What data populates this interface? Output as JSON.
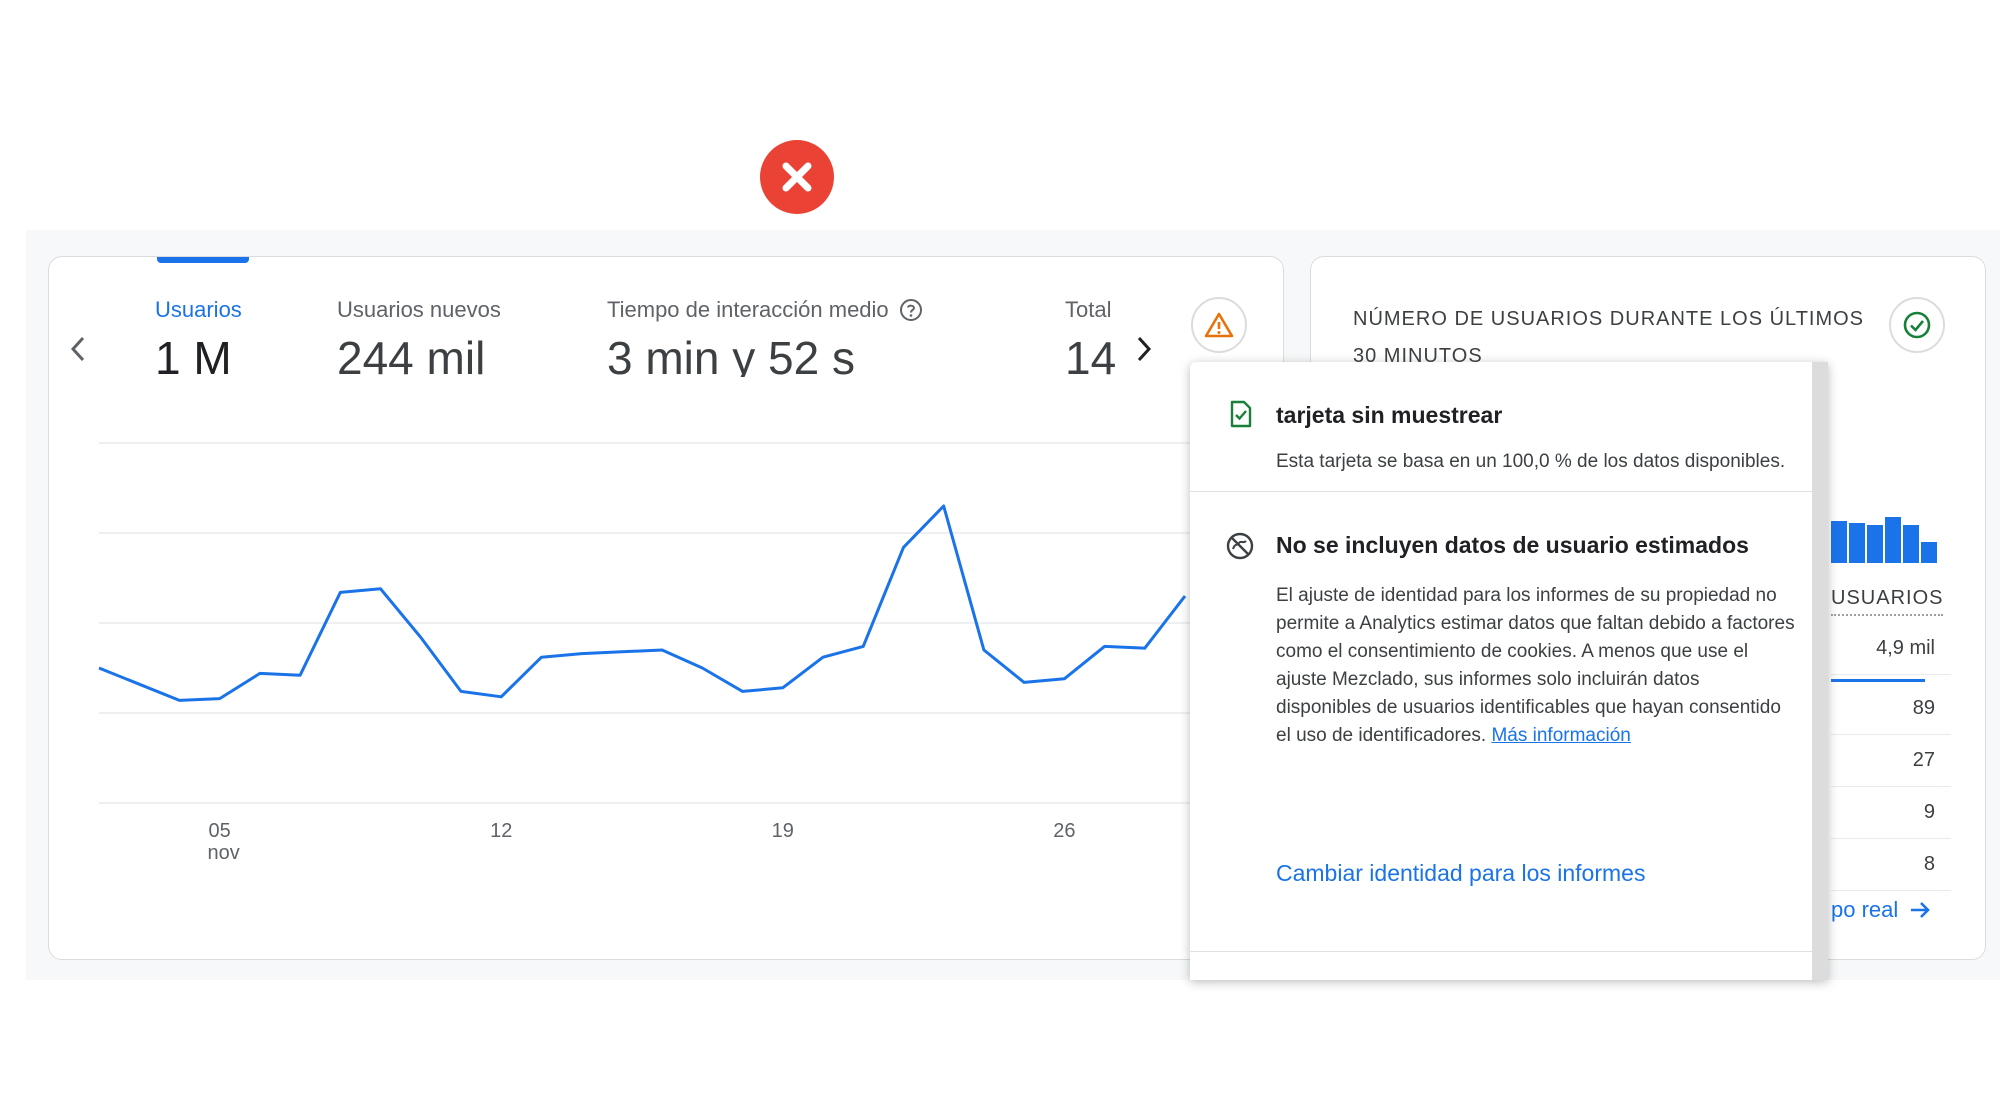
{
  "metrics": [
    {
      "label": "Usuarios",
      "value": "1 M",
      "active": true
    },
    {
      "label": "Usuarios nuevos",
      "value": "244 mil",
      "active": false
    },
    {
      "label": "Tiempo de interacción medio",
      "value": "3 min y 52 s",
      "active": false
    },
    {
      "label": "Total",
      "value": "14",
      "active": false
    }
  ],
  "chart_data": {
    "type": "line",
    "title": "",
    "xlabel": "",
    "ylabel": "",
    "x_ticks": [
      {
        "label": "05",
        "sublabel": "nov",
        "index": 3
      },
      {
        "label": "12",
        "sublabel": "",
        "index": 10
      },
      {
        "label": "19",
        "sublabel": "",
        "index": 17
      },
      {
        "label": "26",
        "sublabel": "",
        "index": 24
      }
    ],
    "y_ticks": [
      "20",
      "15",
      "10",
      "5"
    ],
    "ylim": [
      0,
      20
    ],
    "grid": true,
    "color": "#1a73e8",
    "series": [
      {
        "values": [
          7.5,
          6.6,
          5.7,
          5.8,
          7.2,
          7.1,
          11.7,
          11.9,
          9.2,
          6.2,
          5.9,
          8.1,
          8.3,
          8.4,
          8.5,
          7.5,
          6.2,
          6.4,
          8.1,
          8.7,
          14.2,
          16.5,
          8.5,
          6.7,
          6.9,
          8.7,
          8.6,
          11.5
        ]
      }
    ]
  },
  "realtime": {
    "title": "NÚMERO DE USUARIOS DURANTE LOS ÚLTIMOS 30 MINUTOS",
    "column_header": "USUARIOS",
    "bars": [
      0.75,
      0.72,
      0.68,
      0.82,
      0.68,
      0.38
    ],
    "rows": [
      "4,9 mil",
      "89",
      "27",
      "9",
      "8"
    ],
    "top_row_fraction": 0.9,
    "link_label": "po real"
  },
  "popover": {
    "sections": [
      {
        "icon": "check-document-icon",
        "heading": "tarjeta sin muestrear",
        "body": "Esta tarjeta se basa en un 100,0 % de los datos disponibles."
      },
      {
        "icon": "no-data-icon",
        "heading": "No se incluyen datos de usuario estimados",
        "body": "El ajuste de identidad para los informes de su propiedad no permite a Analytics estimar datos que faltan debido a factores como el consentimiento de cookies. A menos que use el ajuste Mezclado, sus informes solo incluirán datos disponibles de usuarios identificables que hayan consentido el uso de identificadores.",
        "link": "Más información",
        "action": "Cambiar identidad para los informes"
      }
    ]
  },
  "colors": {
    "accent": "#1a73e8",
    "error_badge": "#ea4335",
    "warning": "#e8710a",
    "success": "#188038"
  }
}
